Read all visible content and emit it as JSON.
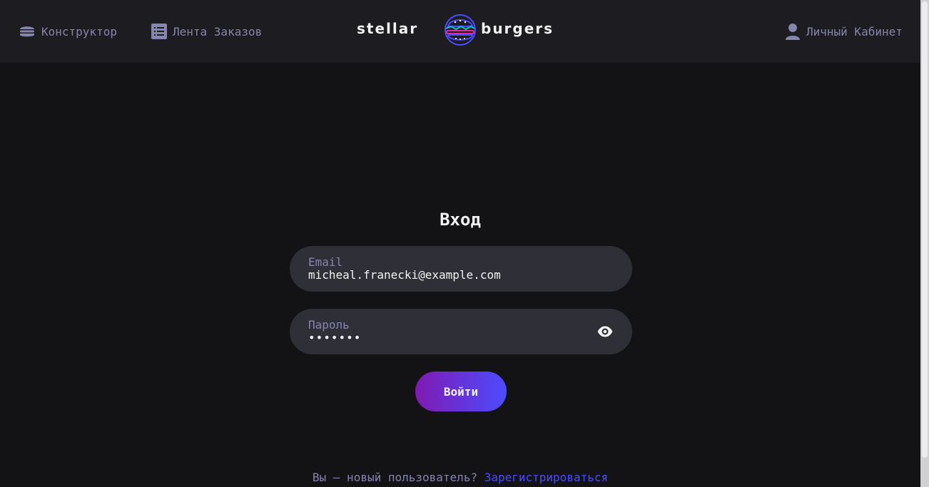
{
  "header": {
    "nav": {
      "constructor_label": "Конструктор",
      "feed_label": "Лента Заказов",
      "account_label": "Личный Кабинет"
    },
    "logo": {
      "left_text": "stellar",
      "right_text": "burgers"
    }
  },
  "login": {
    "title": "Вход",
    "email": {
      "label": "Email",
      "value": "micheal.franecki@example.com"
    },
    "password": {
      "label": "Пароль",
      "value": "•••••••"
    },
    "submit_label": "Войти",
    "register_prompt": "Вы — новый пользователь?",
    "register_link": "Зарегистрироваться"
  },
  "colors": {
    "background": "#131316",
    "header_bg": "#1c1c21",
    "field_bg": "#2f2f37",
    "inactive_text": "#8585ad",
    "accent": "#4c4cff",
    "button_gradient_start": "#801ab3",
    "button_gradient_end": "#4c4cff"
  },
  "icons": {
    "constructor": "burger-icon",
    "feed": "list-icon",
    "account": "profile-icon",
    "password_toggle": "eye-icon"
  }
}
